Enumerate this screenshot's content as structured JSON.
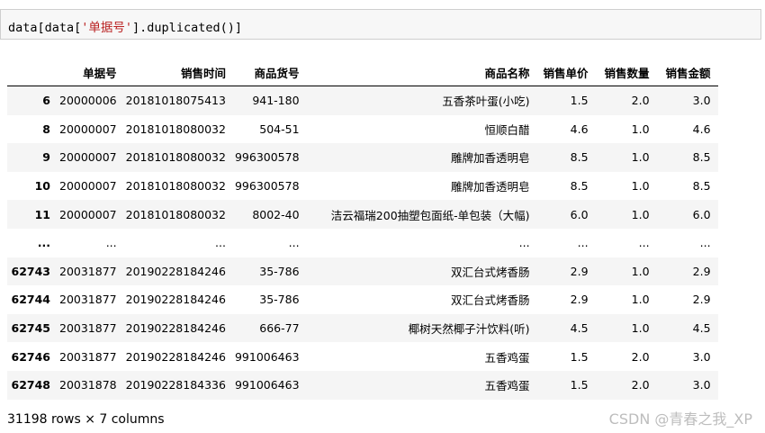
{
  "code": {
    "prefix": "data[data[",
    "string": "'单据号'",
    "suffix": "].duplicated()]"
  },
  "table": {
    "columns": [
      "",
      "单据号",
      "销售时间",
      "商品货号",
      "商品名称",
      "销售单价",
      "销售数量",
      "销售金额"
    ],
    "rows": [
      {
        "index": "6",
        "cells": [
          "20000006",
          "20181018075413",
          "941-180",
          "五香茶叶蛋(小吃)",
          "1.5",
          "2.0",
          "3.0"
        ]
      },
      {
        "index": "8",
        "cells": [
          "20000007",
          "20181018080032",
          "504-51",
          "恒顺白醋",
          "4.6",
          "1.0",
          "4.6"
        ]
      },
      {
        "index": "9",
        "cells": [
          "20000007",
          "20181018080032",
          "996300578",
          "雕牌加香透明皂",
          "8.5",
          "1.0",
          "8.5"
        ]
      },
      {
        "index": "10",
        "cells": [
          "20000007",
          "20181018080032",
          "996300578",
          "雕牌加香透明皂",
          "8.5",
          "1.0",
          "8.5"
        ]
      },
      {
        "index": "11",
        "cells": [
          "20000007",
          "20181018080032",
          "8002-40",
          "洁云福瑞200抽塑包面纸-单包装（大幅)",
          "6.0",
          "1.0",
          "6.0"
        ]
      },
      {
        "index": "...",
        "cells": [
          "...",
          "...",
          "...",
          "...",
          "...",
          "...",
          "..."
        ]
      },
      {
        "index": "62743",
        "cells": [
          "20031877",
          "20190228184246",
          "35-786",
          "双汇台式烤香肠",
          "2.9",
          "1.0",
          "2.9"
        ]
      },
      {
        "index": "62744",
        "cells": [
          "20031877",
          "20190228184246",
          "35-786",
          "双汇台式烤香肠",
          "2.9",
          "1.0",
          "2.9"
        ]
      },
      {
        "index": "62745",
        "cells": [
          "20031877",
          "20190228184246",
          "666-77",
          "椰树天然椰子汁饮料(听)",
          "4.5",
          "1.0",
          "4.5"
        ]
      },
      {
        "index": "62746",
        "cells": [
          "20031877",
          "20190228184246",
          "991006463",
          "五香鸡蛋",
          "1.5",
          "2.0",
          "3.0"
        ]
      },
      {
        "index": "62748",
        "cells": [
          "20031878",
          "20190228184336",
          "991006463",
          "五香鸡蛋",
          "1.5",
          "2.0",
          "3.0"
        ]
      }
    ]
  },
  "shape_info": "31198 rows × 7 columns",
  "watermark": "CSDN @青春之我_XP"
}
